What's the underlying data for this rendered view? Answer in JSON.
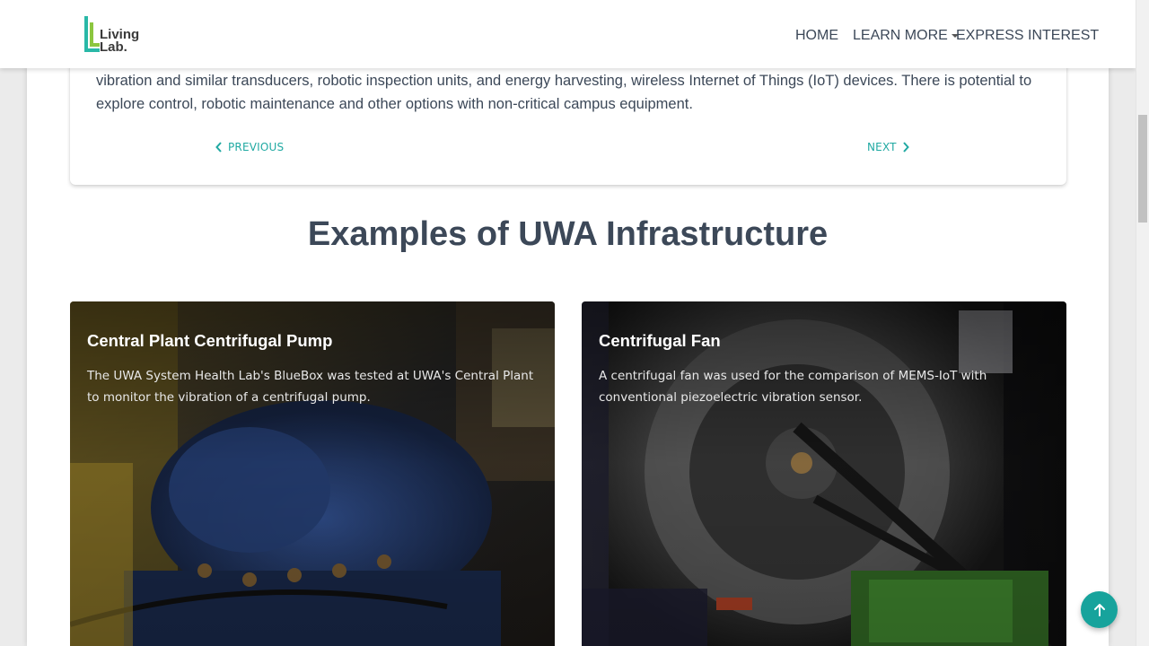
{
  "brand": {
    "logo_line1": "Living",
    "logo_line2": "Lab."
  },
  "nav": {
    "home": "HOME",
    "learn_more": "LEARN MORE",
    "express_interest": "EXPRESS INTEREST"
  },
  "intro": {
    "paragraph": "vibration and similar transducers, robotic inspection units, and energy harvesting, wireless Internet of Things (IoT) devices. There is potential to explore control, robotic maintenance and other options with non-critical campus equipment.",
    "previous_label": "PREVIOUS",
    "next_label": "NEXT"
  },
  "section": {
    "title": "Examples of UWA Infrastructure"
  },
  "cards": [
    {
      "title": "Central Plant Centrifugal Pump",
      "description": "The UWA System Health Lab's BlueBox was tested at UWA's Central Plant to monitor the vibration of a centrifugal pump."
    },
    {
      "title": "Centrifugal Fan",
      "description": "A centrifugal fan was used for the comparison of MEMS-IoT with conventional piezoelectric vibration sensor."
    }
  ],
  "colors": {
    "accent": "#20a9a2",
    "back_to_top": "#17a39c",
    "heading": "#3c4858"
  },
  "icons": {
    "previous": "chevron-left-icon",
    "next": "chevron-right-icon",
    "learn_more_caret": "caret-down-icon",
    "back_to_top": "arrow-up-icon"
  }
}
